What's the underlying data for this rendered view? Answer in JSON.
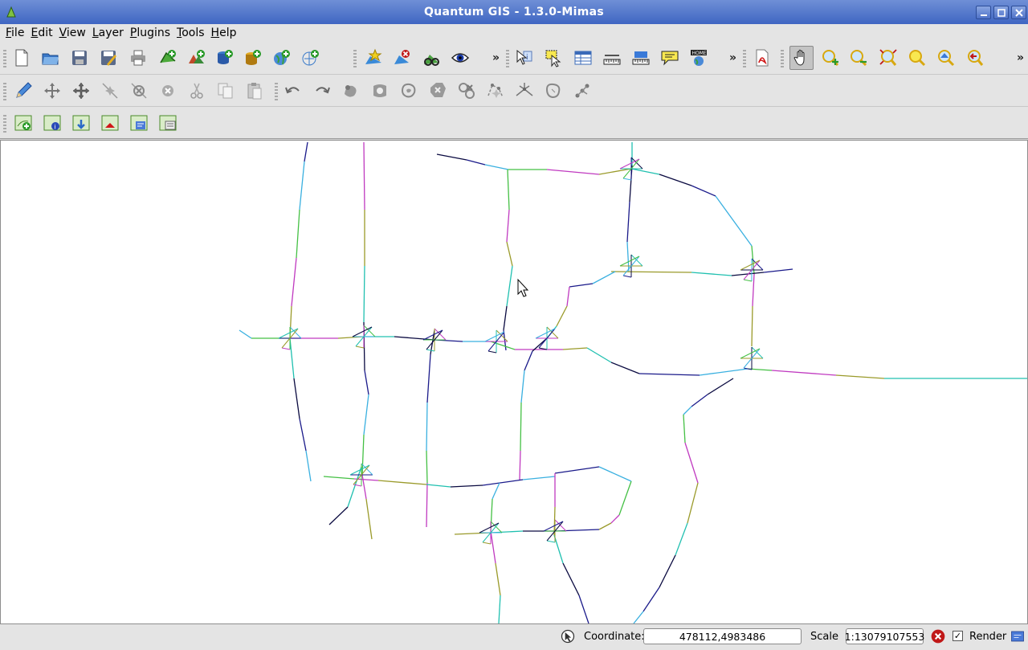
{
  "window": {
    "title": "Quantum GIS - 1.3.0-Mimas",
    "controls": [
      "minimize",
      "maximize",
      "close"
    ]
  },
  "menu": [
    {
      "label": "File",
      "u": "F",
      "rest": "ile"
    },
    {
      "label": "Edit",
      "u": "E",
      "rest": "dit"
    },
    {
      "label": "View",
      "u": "V",
      "rest": "iew"
    },
    {
      "label": "Layer",
      "u": "L",
      "rest": "ayer"
    },
    {
      "label": "Plugins",
      "u": "P",
      "rest": "lugins"
    },
    {
      "label": "Tools",
      "u": "T",
      "rest": "ools"
    },
    {
      "label": "Help",
      "u": "H",
      "rest": "elp"
    }
  ],
  "toolbars": {
    "file": [
      "new-project",
      "open-project",
      "save-project",
      "save-project-as",
      "print-composer"
    ],
    "layers": [
      "add-vector-layer",
      "add-raster-layer",
      "add-postgis-layer",
      "add-spatialite-layer",
      "add-wms-layer",
      "add-wfs-layer"
    ],
    "plugins": [
      "new-bookmark",
      "remove-layer",
      "georeferencer",
      "toggle-editing-overview"
    ],
    "attributes": [
      "identify",
      "select-features",
      "open-attribute-table",
      "measure-line",
      "measure-area",
      "map-tips",
      "show-bookmarks"
    ],
    "export": [
      "export-pdf"
    ],
    "navigation": [
      "pan",
      "zoom-in",
      "zoom-out",
      "zoom-full",
      "zoom-to-selection",
      "zoom-to-layer",
      "zoom-last"
    ],
    "digitizing": [
      "toggle-editing",
      "capture-point",
      "move-feature",
      "add-vertex",
      "delete-vertex",
      "delete-selected",
      "cut-features",
      "copy-features",
      "paste-features",
      "undo",
      "redo",
      "simplify",
      "add-ring",
      "add-island",
      "delete-ring",
      "delete-part",
      "reshape",
      "split-features",
      "merge-features",
      "merge-attributes",
      "rotate-point-symbols"
    ],
    "ogc": [
      "add-wms-server",
      "layer-info",
      "import-data",
      "delete-layer",
      "export-data",
      "layer-properties"
    ]
  },
  "overflow_glyph": "»",
  "status": {
    "coordinate_label": "Coordinate:",
    "coordinate_value": "478112,4983486",
    "scale_label": "Scale",
    "scale_value": "1:13079107553",
    "render_label": "Render",
    "render_checked": true
  },
  "colors": {
    "titlebar": "#4a6fc6",
    "road_colors": [
      "#1a1a8a",
      "#3ab0e0",
      "#44c044",
      "#c03ac0",
      "#9a9a2a",
      "#20c0b0",
      "#0a0a40"
    ]
  }
}
